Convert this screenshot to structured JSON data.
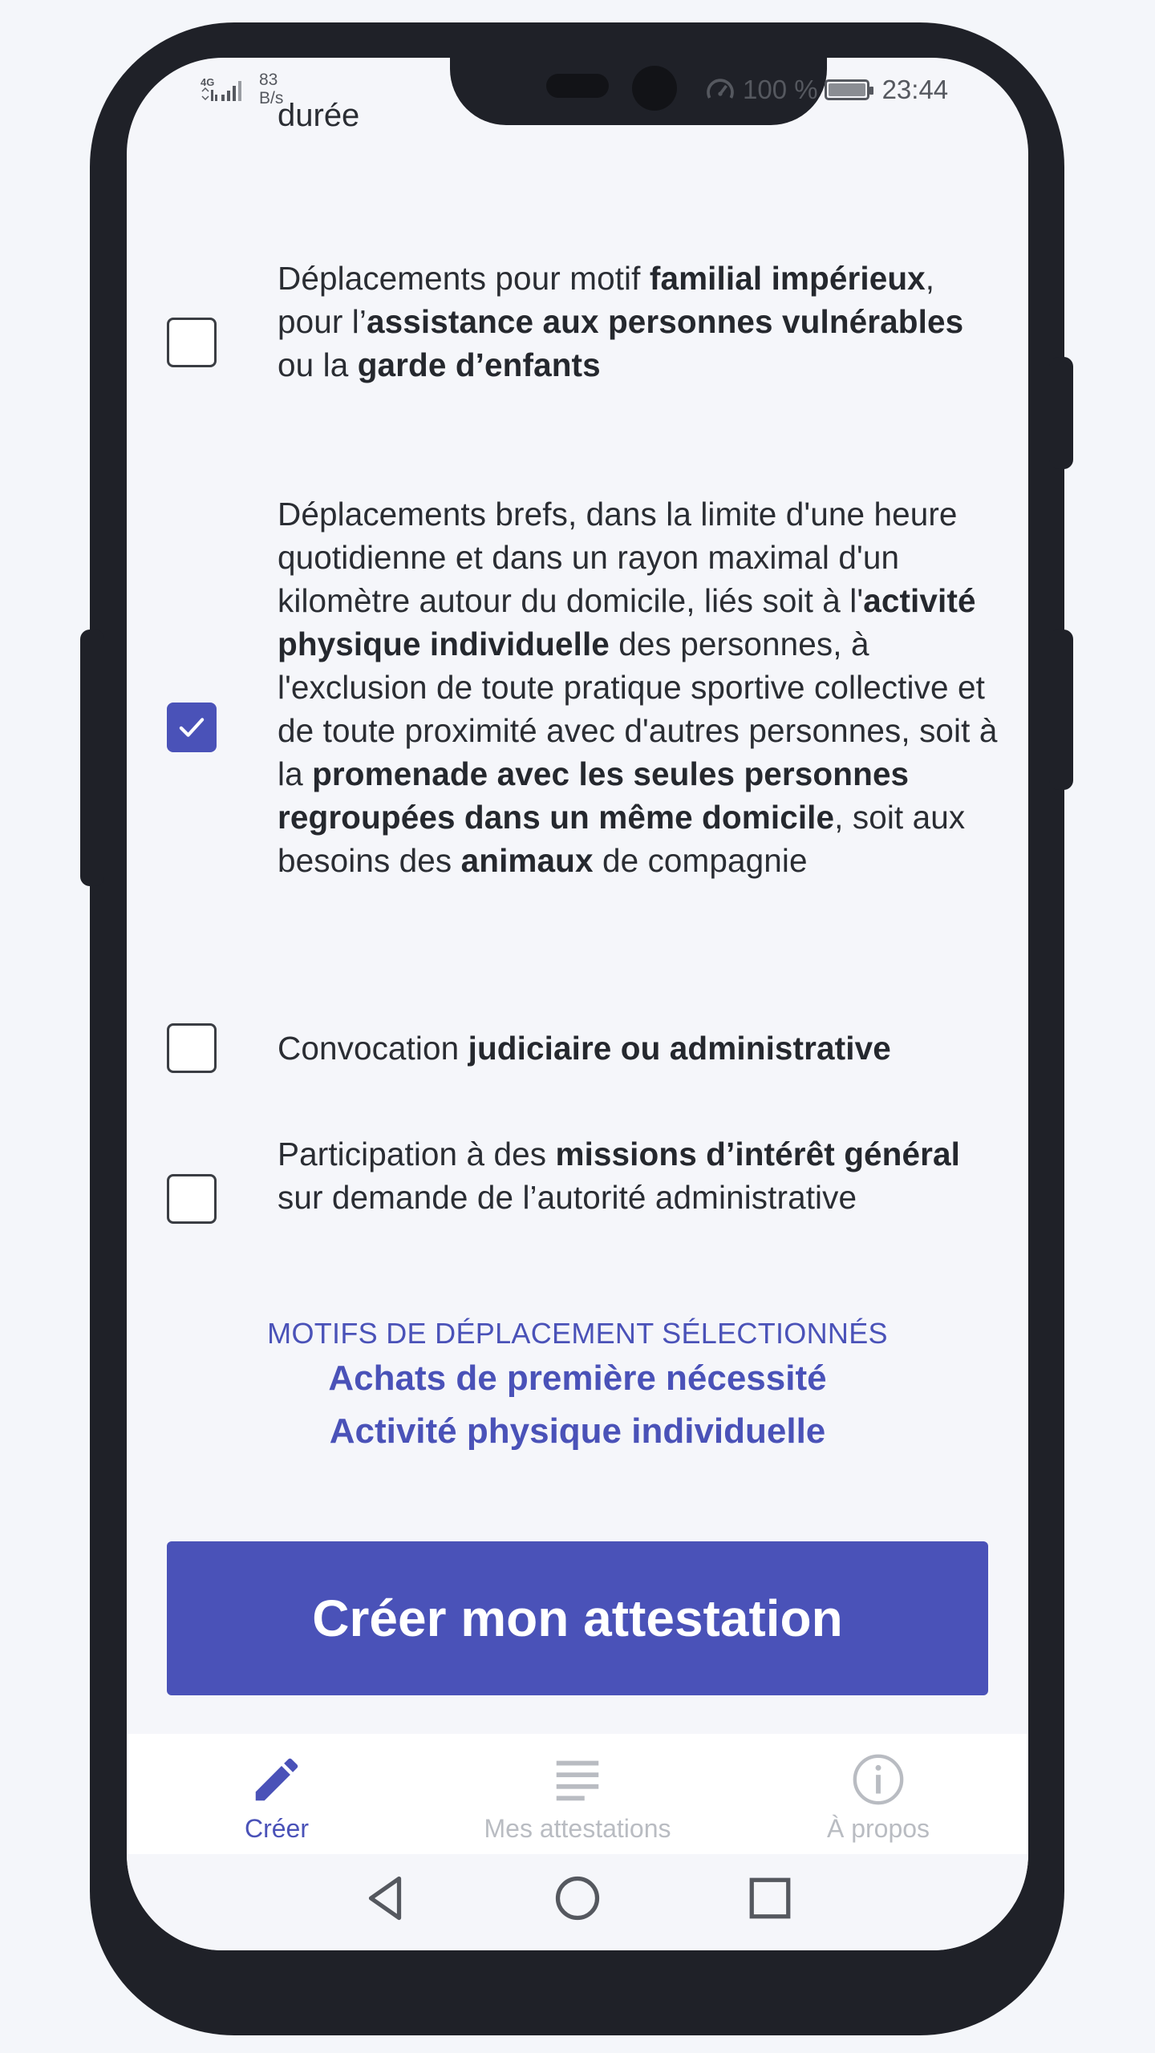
{
  "status_bar": {
    "network_type": "4G",
    "speed_value": "83",
    "speed_unit": "B/s",
    "battery_percent": "100 %",
    "time": "23:44"
  },
  "motifs": {
    "clipped_previous": "durée",
    "items": [
      {
        "checked": false,
        "segments": [
          {
            "t": "Déplacements pour motif ",
            "b": false
          },
          {
            "t": "familial impérieux",
            "b": true
          },
          {
            "t": ", pour l’",
            "b": false
          },
          {
            "t": "assistance aux personnes vulnérables",
            "b": true
          },
          {
            "t": " ou la ",
            "b": false
          },
          {
            "t": "garde d’enfants",
            "b": true
          }
        ]
      },
      {
        "checked": true,
        "segments": [
          {
            "t": "Déplacements brefs, dans la limite d'une heure quotidienne et dans un rayon maximal d'un kilomètre autour du domicile, liés soit à l'",
            "b": false
          },
          {
            "t": "activité physique individuelle",
            "b": true
          },
          {
            "t": " des personnes, à l'exclusion de toute pratique sportive collective et de toute proximité avec d'autres personnes, soit à la ",
            "b": false
          },
          {
            "t": "promenade avec les seules personnes regroupées dans un même domicile",
            "b": true
          },
          {
            "t": ", soit aux besoins des ",
            "b": false
          },
          {
            "t": "animaux",
            "b": true
          },
          {
            "t": " de compagnie",
            "b": false
          }
        ]
      },
      {
        "checked": false,
        "segments": [
          {
            "t": "Convocation ",
            "b": false
          },
          {
            "t": "judiciaire ou administrative",
            "b": true
          }
        ]
      },
      {
        "checked": false,
        "segments": [
          {
            "t": "Participation à des ",
            "b": false
          },
          {
            "t": "missions d’intérêt général",
            "b": true
          },
          {
            "t": " sur demande de l’autorité administrative",
            "b": false
          }
        ]
      }
    ]
  },
  "selected": {
    "title": "MOTIFS DE DÉPLACEMENT SÉLECTIONNÉS",
    "items": [
      "Achats de première nécessité",
      "Activité physique individuelle"
    ]
  },
  "create_button": {
    "label": "Créer mon attestation"
  },
  "bottom_nav": {
    "items": [
      {
        "label": "Créer",
        "icon": "pencil-icon",
        "active": true
      },
      {
        "label": "Mes attestations",
        "icon": "list-icon",
        "active": false
      },
      {
        "label": "À propos",
        "icon": "info-icon",
        "active": false
      }
    ]
  },
  "colors": {
    "accent": "#4a52b8",
    "text": "#2a2d33",
    "inactive": "#b9bcc2",
    "frame": "#1f2128"
  }
}
